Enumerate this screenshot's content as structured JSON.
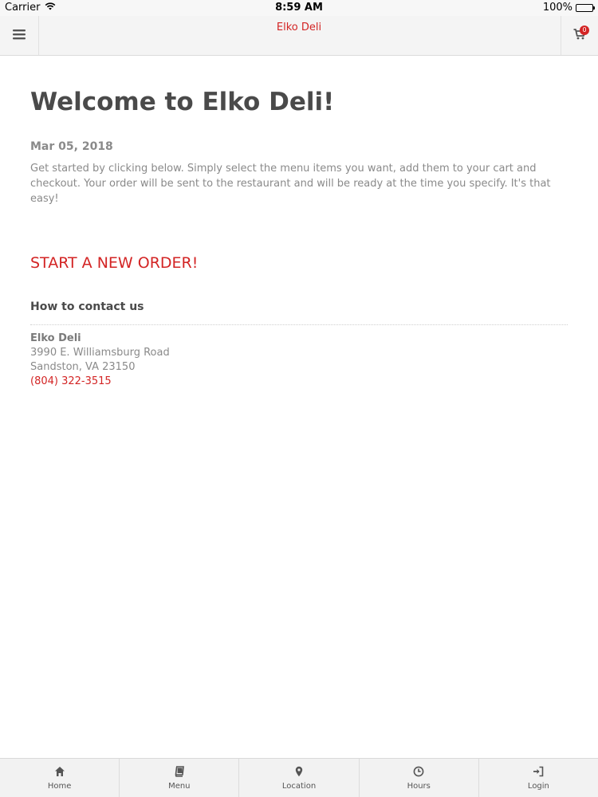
{
  "status_bar": {
    "carrier": "Carrier",
    "time": "8:59 AM",
    "battery": "100%"
  },
  "header": {
    "title": "Elko Deli",
    "cart_count": "0"
  },
  "main": {
    "title": "Welcome to Elko Deli!",
    "date": "Mar 05, 2018",
    "intro": "Get started by clicking below. Simply select the menu items you want, add them to your cart and checkout. Your order will be sent to the restaurant and will be ready at the time you specify. It's that easy!",
    "start_order": "START A NEW ORDER!",
    "contact_heading": "How to contact us",
    "contact": {
      "name": "Elko Deli",
      "address1": "3990 E. Williamsburg Road",
      "address2": "Sandston, VA 23150",
      "phone": "(804) 322-3515"
    }
  },
  "tabs": [
    {
      "label": "Home",
      "icon": "home-icon"
    },
    {
      "label": "Menu",
      "icon": "book-icon"
    },
    {
      "label": "Location",
      "icon": "map-pin-icon"
    },
    {
      "label": "Hours",
      "icon": "clock-icon"
    },
    {
      "label": "Login",
      "icon": "login-icon"
    }
  ],
  "colors": {
    "accent": "#d32424",
    "text_dark": "#4a4a4a",
    "text_muted": "#8a8a8a"
  }
}
